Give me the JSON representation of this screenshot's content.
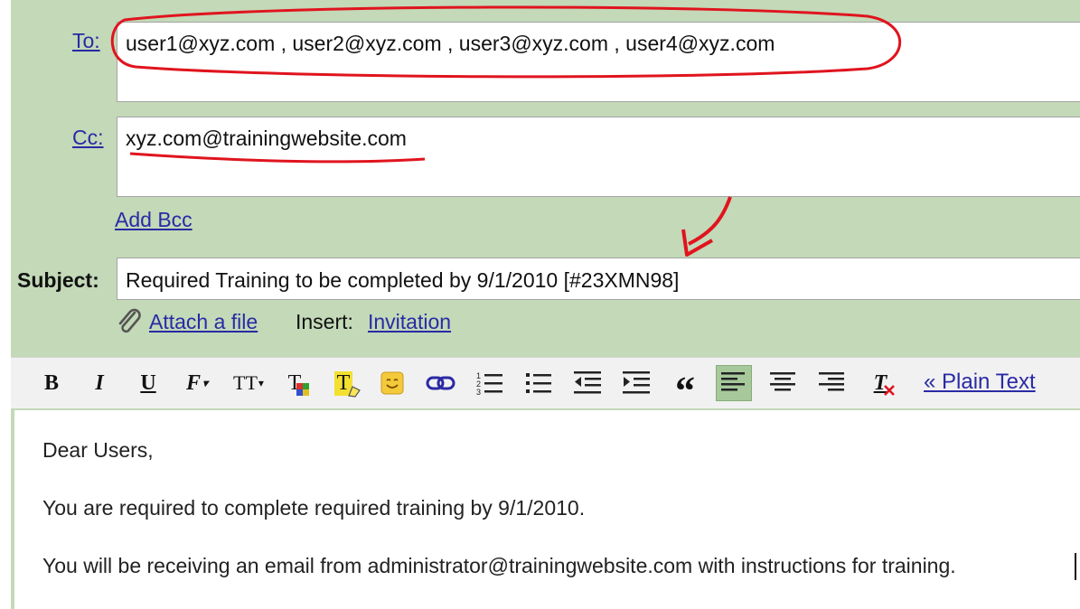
{
  "compose": {
    "to_label": "To:",
    "to_value": "user1@xyz.com , user2@xyz.com , user3@xyz.com , user4@xyz.com",
    "cc_label": "Cc:",
    "cc_value": "xyz.com@trainingwebsite.com",
    "add_bcc": "Add Bcc",
    "subject_label": "Subject:",
    "subject_value": "Required Training to be completed by 9/1/2010 [#23XMN98]",
    "attach_label": "Attach a file",
    "insert_label": "Insert:",
    "invitation_label": "Invitation"
  },
  "toolbar": {
    "bold": "B",
    "italic": "I",
    "underline": "U",
    "font": "F",
    "size": "TT",
    "text_color": "T",
    "highlight": "T",
    "quote": "“",
    "remove_format": "T",
    "plain_text": "« Plain Text",
    "active_button": "align-left"
  },
  "body": {
    "line1": "Dear Users,",
    "line2": "You are required to complete required training by 9/1/2010.",
    "line3": "You will be receiving an email from administrator@trainingwebsite.com with instructions for training."
  },
  "colors": {
    "panel_green": "#c3d9b8",
    "link_blue": "#2a2aa5",
    "annotation_red": "#e0141e",
    "active_tool": "#a6c89a"
  },
  "icons": [
    "paperclip-icon",
    "chevron-down-icon",
    "emoticon-icon",
    "link-icon",
    "numbered-list-icon",
    "bullet-list-icon",
    "indent-less-icon",
    "indent-more-icon",
    "quote-icon",
    "align-left-icon",
    "align-center-icon",
    "align-right-icon",
    "remove-formatting-icon",
    "text-cursor"
  ]
}
